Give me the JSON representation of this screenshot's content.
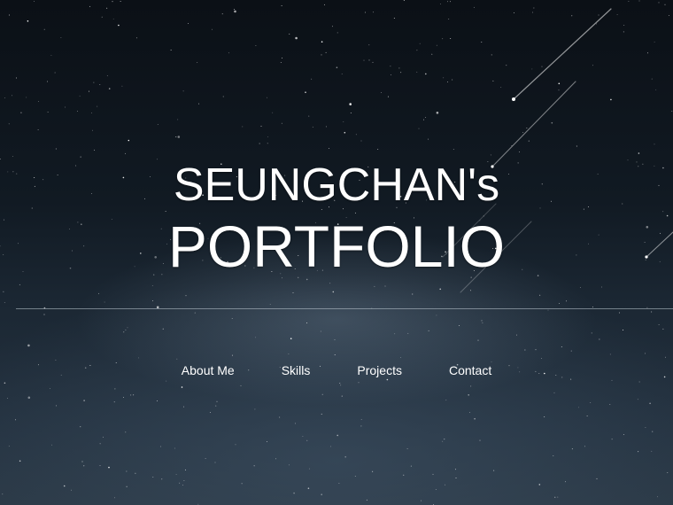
{
  "hero": {
    "title_line1": "SEUNGCHAN's",
    "title_line2": "PORTFOLIO"
  },
  "nav": {
    "items": [
      {
        "label": "About Me"
      },
      {
        "label": "Skills"
      },
      {
        "label": "Projects"
      },
      {
        "label": "Contact"
      }
    ]
  },
  "colors": {
    "text": "#ffffff",
    "sky_top": "#0b1016",
    "sky_bottom": "#2a3845",
    "divider": "#bec8d2"
  }
}
